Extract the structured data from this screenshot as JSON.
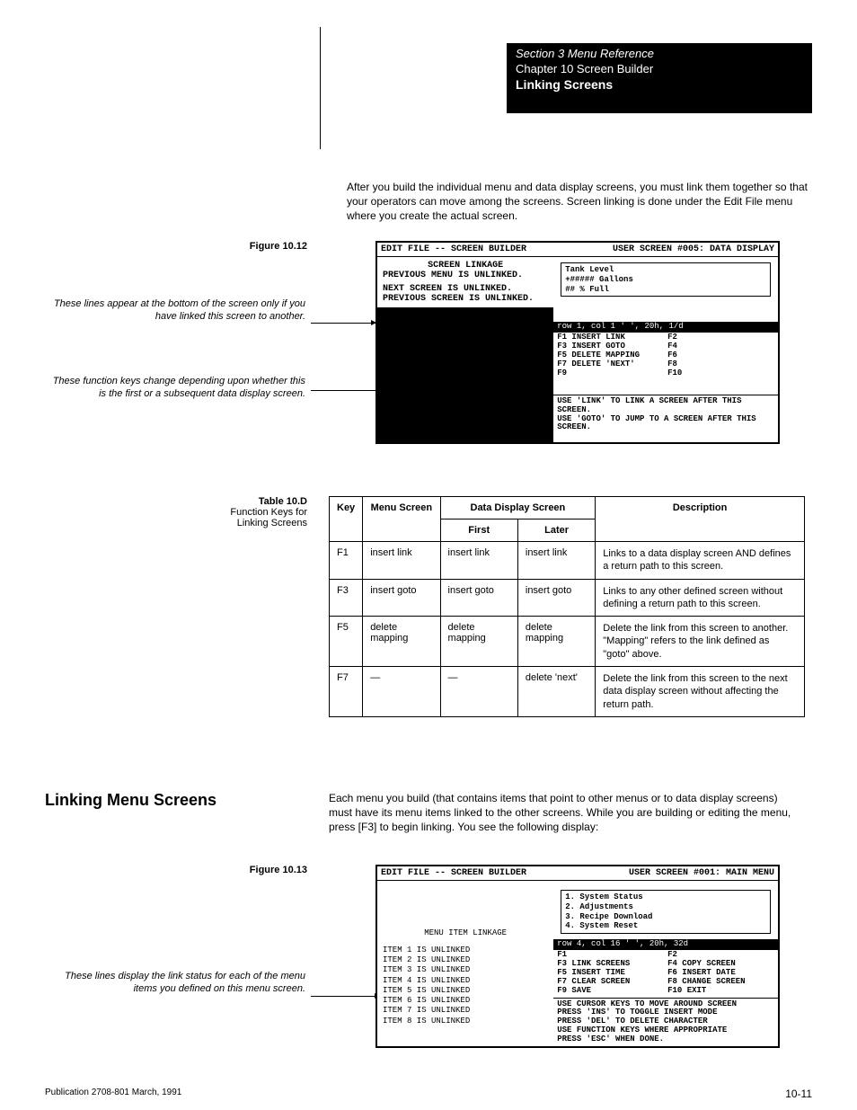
{
  "header": {
    "section": "Section 3 Menu Reference",
    "chapter": "Chapter 10 Screen Builder",
    "subhead": "Linking Screens"
  },
  "intro_para": "After you build the individual menu and data display screens, you must link them together so that your operators can move among the screens. Screen linking is done under the Edit File menu where you create the actual screen.",
  "fig1": {
    "num": "Figure 10.12"
  },
  "callout1": "These lines appear at the bottom of the screen only if you have linked this screen to another.",
  "callout2": "These function keys change depending upon whether this is the first or a subsequent data display screen.",
  "dos1": {
    "title_left": "EDIT FILE -- SCREEN BUILDER",
    "title_right": "USER SCREEN #005: DATA DISPLAY",
    "link_title": "SCREEN LINKAGE",
    "link_lines": [
      "PREVIOUS MENU IS UNLINKED.",
      "NEXT SCREEN IS UNLINKED.",
      "PREVIOUS SCREEN IS UNLINKED."
    ],
    "mini": [
      "Tank Level",
      "+##### Gallons",
      "## % Full"
    ],
    "bar": "row   1, col  1       ' ',  20h,  1/d",
    "fkeys": [
      "F1 INSERT LINK",
      "F2",
      "F3 INSERT GOTO",
      "F4",
      "F5 DELETE MAPPING",
      "F6",
      "F7 DELETE 'NEXT'",
      "F8",
      "F9",
      "F10"
    ],
    "msg": [
      "USE 'LINK' TO LINK A SCREEN AFTER THIS SCREEN.",
      "USE 'GOTO' TO JUMP TO A SCREEN AFTER THIS SCREEN."
    ]
  },
  "table": {
    "label": "Table 10.D",
    "title": "Function Keys for Linking Screens",
    "header": [
      "Key",
      "Menu Screen",
      "First",
      "Later",
      "Description"
    ],
    "sub": "Data Display Screen",
    "rows": [
      {
        "key": "F1",
        "menu": "insert link",
        "first": "insert link",
        "later": "insert link",
        "desc": "Links to a data display screen AND defines a return path to this screen."
      },
      {
        "key": "F3",
        "menu": "insert goto",
        "first": "insert goto",
        "later": "insert goto",
        "desc": "Links to any other defined screen without defining a return path to this screen."
      },
      {
        "key": "F5",
        "menu": "delete mapping",
        "first": "delete mapping",
        "later": "delete mapping",
        "desc": "Delete the link from this screen to another. \"Mapping\" refers to the link defined as \"goto\" above."
      },
      {
        "key": "F7",
        "menu": "—",
        "first": "—",
        "later": "delete 'next'",
        "desc": "Delete the link from this screen to the next data display screen without affecting the return path."
      }
    ]
  },
  "linking_menu": {
    "title": "Linking Menu Screens",
    "para": "Each menu you build (that contains items that point to other menus or to data display screens) must have its menu items linked to the other screens. While you are building or editing the menu, press [F3] to begin linking. You see the following display:"
  },
  "fig2": {
    "num": "Figure 10.13"
  },
  "callout3": "These lines display the link status for each of the menu items you defined on this menu screen.",
  "dos2": {
    "title_left": "EDIT FILE -- SCREEN BUILDER",
    "title_right": "USER SCREEN #001: MAIN MENU",
    "left_title": "MENU ITEM LINKAGE",
    "items": [
      "ITEM 1 IS UNLINKED",
      "ITEM 2 IS UNLINKED",
      "ITEM 3 IS UNLINKED",
      "ITEM 4 IS UNLINKED",
      "ITEM 5 IS UNLINKED",
      "ITEM 6 IS UNLINKED",
      "ITEM 7 IS UNLINKED",
      "ITEM 8 IS UNLINKED"
    ],
    "mini": [
      "1. System Status",
      "2. Adjustments",
      "3. Recipe Download",
      "4. System Reset"
    ],
    "bar": "row  4, col 16       ' ',  20h,  32d",
    "fkeys": [
      "F1",
      "F2",
      "F3 LINK SCREENS",
      "F4  COPY SCREEN",
      "F5 INSERT TIME",
      "F6  INSERT DATE",
      "F7 CLEAR SCREEN",
      "F8  CHANGE SCREEN",
      "F9 SAVE",
      "F10 EXIT"
    ],
    "msg": [
      "USE CURSOR KEYS TO MOVE AROUND SCREEN",
      "PRESS 'INS' TO TOGGLE INSERT MODE",
      "PRESS 'DEL' TO DELETE CHARACTER",
      "USE FUNCTION KEYS WHERE APPROPRIATE",
      "PRESS 'ESC' WHEN DONE."
    ]
  },
  "footer": {
    "pub": "Publication 2708-801   March, 1991",
    "page": "10-11"
  }
}
